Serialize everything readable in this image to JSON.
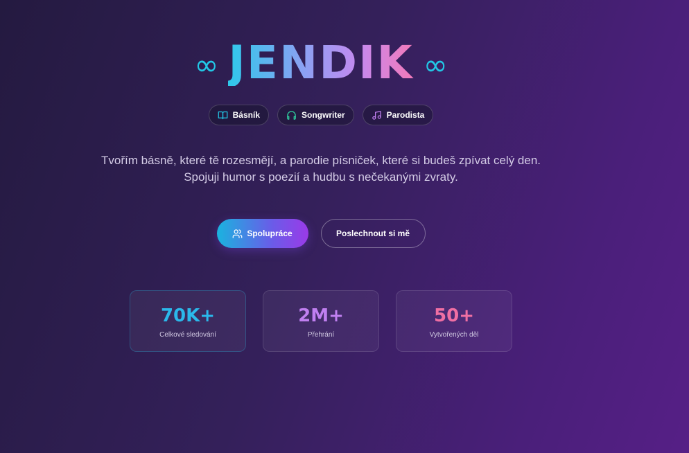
{
  "hero": {
    "infinity_symbol": "∞",
    "title": "JENDIK"
  },
  "tags": [
    {
      "label": "Básník",
      "icon": "book-open-icon"
    },
    {
      "label": "Songwriter",
      "icon": "headphones-icon"
    },
    {
      "label": "Parodista",
      "icon": "music-note-icon"
    }
  ],
  "description": {
    "line1": "Tvořím básně, které tě rozesmějí, a parodie písniček, které si budeš zpívat celý den.",
    "line2": "Spojuji humor s poezií a hudbu s nečekanými zvraty."
  },
  "cta": {
    "primary_label": "Spolupráce",
    "primary_icon": "users-icon",
    "secondary_label": "Poslechnout si mě"
  },
  "stats": [
    {
      "value": "70K+",
      "label": "Celkové sledování",
      "color": "#2bb8ea"
    },
    {
      "value": "2M+",
      "label": "Přehrání",
      "color": "#c07ff0"
    },
    {
      "value": "50+",
      "label": "Vytvořených děl",
      "color": "#f06fa3"
    }
  ],
  "colors": {
    "accent_cyan": "#22c7e6",
    "accent_purple": "#9a3ae8",
    "accent_pink": "#f37ab9"
  }
}
